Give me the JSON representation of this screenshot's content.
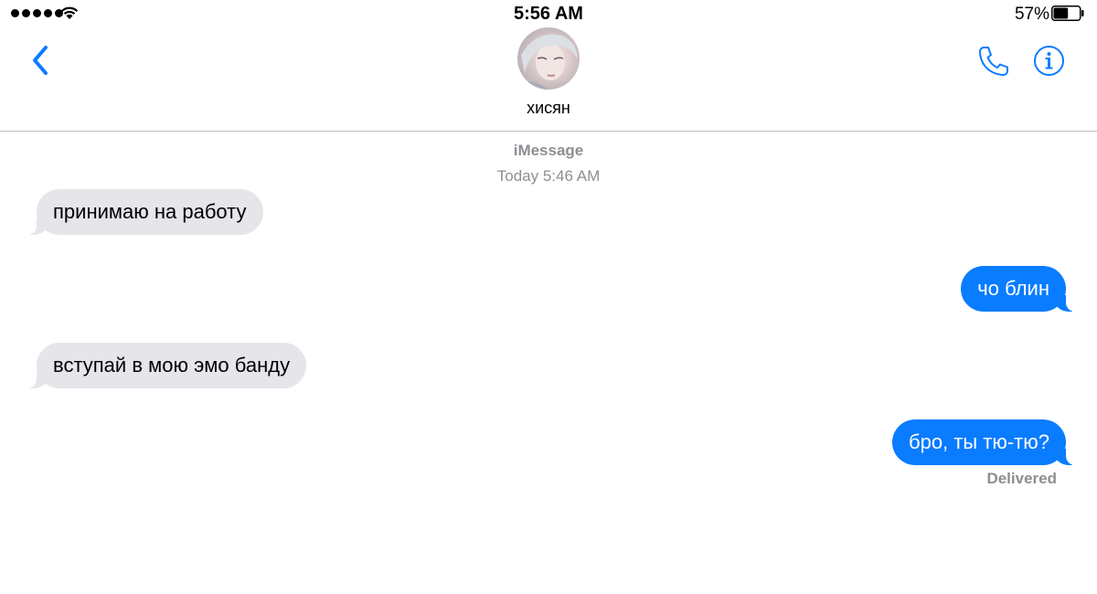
{
  "status_bar": {
    "time": "5:56 AM",
    "battery_percent": "57%",
    "battery_level": 0.57,
    "signal_bars": 5,
    "wifi_icon": "wifi-icon"
  },
  "nav": {
    "back_icon": "chevron-left-icon",
    "contact_name": "хисян",
    "phone_icon": "phone-icon",
    "info_icon": "info-icon"
  },
  "thread": {
    "service": "iMessage",
    "timestamp": "Today 5:46 AM",
    "messages": [
      {
        "direction": "incoming",
        "text": "принимаю на работу"
      },
      {
        "direction": "outgoing",
        "text": "чо блин"
      },
      {
        "direction": "incoming",
        "text": "вступай в мою эмо банду"
      },
      {
        "direction": "outgoing",
        "text": "бро, ты тю-тю?"
      }
    ],
    "delivery_status": "Delivered"
  },
  "colors": {
    "accent": "#0a7cff",
    "incoming_bubble": "#e5e5ea",
    "secondary_text": "#8e8e93"
  }
}
